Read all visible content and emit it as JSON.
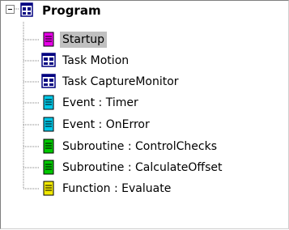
{
  "tree": {
    "root": {
      "label": "Program",
      "icon": "program-icon",
      "expanded": true
    },
    "items": [
      {
        "label": "Startup",
        "icon": "document-icon",
        "color": "#e800e8",
        "selected": true
      },
      {
        "label": "Task Motion",
        "icon": "task-icon",
        "selected": false
      },
      {
        "label": "Task CaptureMonitor",
        "icon": "task-icon",
        "selected": false
      },
      {
        "label": "Event : Timer",
        "icon": "document-icon",
        "color": "#00c8e8",
        "selected": false
      },
      {
        "label": "Event : OnError",
        "icon": "document-icon",
        "color": "#00c8e8",
        "selected": false
      },
      {
        "label": "Subroutine : ControlChecks",
        "icon": "document-icon",
        "color": "#00c800",
        "selected": false
      },
      {
        "label": "Subroutine : CalculateOffset",
        "icon": "document-icon",
        "color": "#00c800",
        "selected": false
      },
      {
        "label": "Function : Evaluate",
        "icon": "document-icon",
        "color": "#f0e800",
        "selected": false
      }
    ]
  },
  "colors": {
    "selection": "#c0c0c0",
    "tree_lines": "#808080"
  }
}
